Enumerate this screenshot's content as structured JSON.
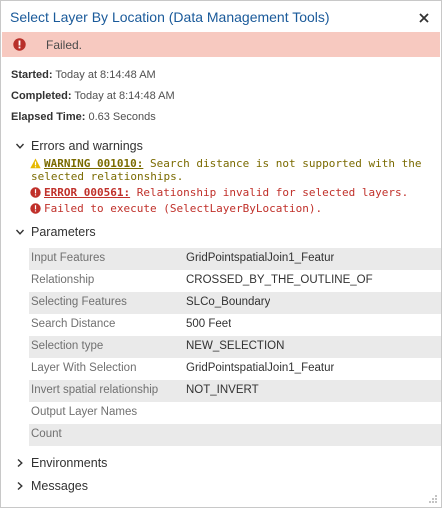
{
  "window": {
    "title": "Select Layer By Location (Data Management Tools)",
    "close_icon": "close-icon"
  },
  "status": {
    "text": "Failed.",
    "icon": "error-icon",
    "color": "#f7c9c0"
  },
  "meta": {
    "started_label": "Started:",
    "started_value": " Today at 8:14:48 AM",
    "completed_label": "Completed:",
    "completed_value": " Today at 8:14:48 AM",
    "elapsed_label": "Elapsed Time:",
    "elapsed_value": " 0.63 Seconds"
  },
  "errors_section": {
    "label": "Errors and warnings",
    "messages": [
      {
        "type": "warning",
        "code": "WARNING 001010:",
        "text": " Search distance is not supported with the",
        "continuation": "selected relationships."
      },
      {
        "type": "error",
        "code": "ERROR 000561:",
        "text": " Relationship invalid for selected layers."
      },
      {
        "type": "error",
        "code": "",
        "text": "Failed to execute (SelectLayerByLocation)."
      }
    ]
  },
  "parameters_section": {
    "label": "Parameters",
    "rows": [
      {
        "name": "Input Features",
        "value": "GridPointspatialJoin1_Featur"
      },
      {
        "name": "Relationship",
        "value": "CROSSED_BY_THE_OUTLINE_OF"
      },
      {
        "name": "Selecting Features",
        "value": "SLCo_Boundary"
      },
      {
        "name": "Search Distance",
        "value": "500 Feet"
      },
      {
        "name": "Selection type",
        "value": "NEW_SELECTION"
      },
      {
        "name": "Layer With Selection",
        "value": "GridPointspatialJoin1_Featur"
      },
      {
        "name": "Invert spatial relationship",
        "value": "NOT_INVERT"
      },
      {
        "name": "Output Layer Names",
        "value": ""
      },
      {
        "name": "Count",
        "value": ""
      }
    ]
  },
  "environments_section": {
    "label": "Environments"
  },
  "messages_section": {
    "label": "Messages"
  },
  "colors": {
    "title": "#1a5a9a",
    "warning": "#7a6a00",
    "error": "#c0302a"
  }
}
